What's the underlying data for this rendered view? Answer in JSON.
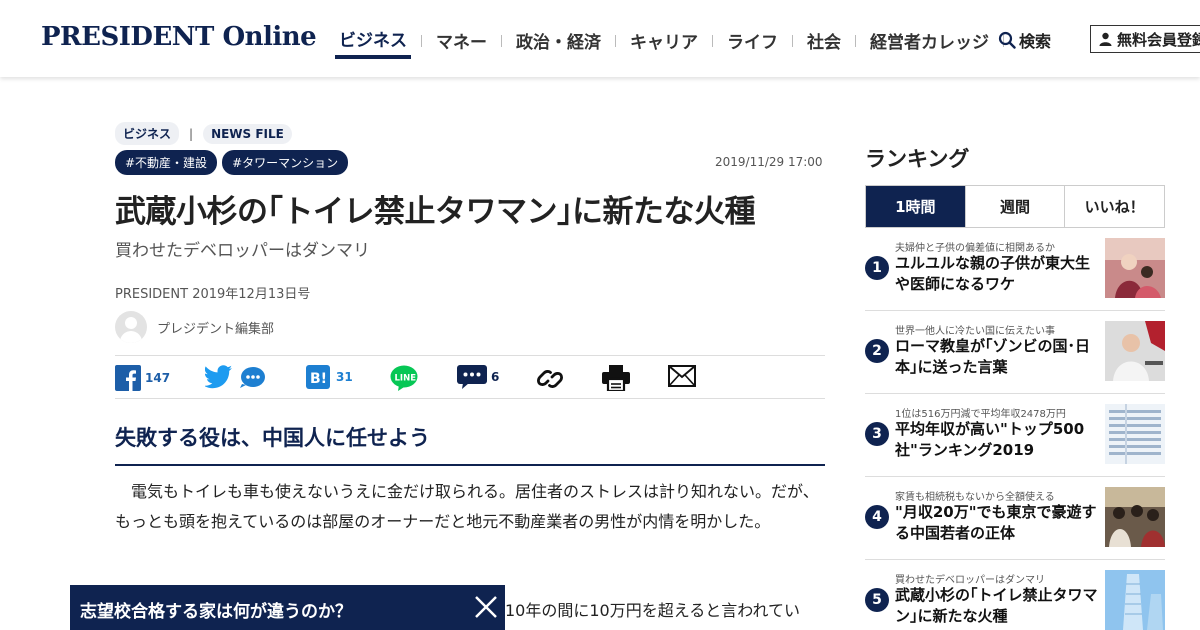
{
  "header": {
    "logo": "PRESIDENT Online",
    "nav": [
      "ビジネス",
      "マネー",
      "政治・経済",
      "キャリア",
      "ライフ",
      "社会",
      "経営者カレッジ"
    ],
    "search_label": "検索",
    "member_label": "無料会員登録"
  },
  "article": {
    "category": "ビジネス",
    "subcategory": "NEWS FILE",
    "tags": [
      "#不動産・建設",
      "#タワーマンション"
    ],
    "date": "2019/11/29 17:00",
    "title": "武蔵小杉の｢トイレ禁止タワマン｣に新たな火種",
    "subtitle": "買わせたデベロッパーはダンマリ",
    "publication": "PRESIDENT 2019年12月13日号",
    "author": "プレジデント編集部",
    "share": {
      "facebook_count": "147",
      "hatena_count": "31",
      "comment_count": "6"
    },
    "section_heading": "失敗する役は、中国人に任せよう",
    "paragraph1": "電気もトイレも車も使えないうえに金だけ取られる。居住者のストレスは計り知れない。だが、もっとも頭を抱えているのは部屋のオーナーだと地元不動産業者の男性が内情を明かした。",
    "paragraph2_visible": "10年の間に10万円を超えると言われてい"
  },
  "ranking": {
    "title": "ランキング",
    "tabs": [
      "1時間",
      "週間",
      "いいね！"
    ],
    "items": [
      {
        "num": "1",
        "lead": "夫婦仲と子供の偏差値に相関あるか",
        "headline": "ユルユルな親の子供が東大生や医師になるワケ"
      },
      {
        "num": "2",
        "lead": "世界一他人に冷たい国に伝えたい事",
        "headline": "ローマ教皇が｢ゾンビの国･日本｣に送った言葉"
      },
      {
        "num": "3",
        "lead": "1位は516万円減で平均年収2478万円",
        "headline": "平均年収が高い\"トップ500社\"ランキング2019"
      },
      {
        "num": "4",
        "lead": "家賃も相続税もないから全額使える",
        "headline": "\"月収20万\"でも東京で豪遊する中国若者の正体"
      },
      {
        "num": "5",
        "lead": "買わせたデベロッパーはダンマリ",
        "headline": "武蔵小杉の｢トイレ禁止タワマン｣に新たな火種"
      }
    ]
  },
  "banner": {
    "text": "志望校合格する家は何が違うのか？"
  },
  "colors": {
    "brand_navy": "#0f2350",
    "link_blue": "#1d7fd1",
    "line_green": "#06c755"
  }
}
